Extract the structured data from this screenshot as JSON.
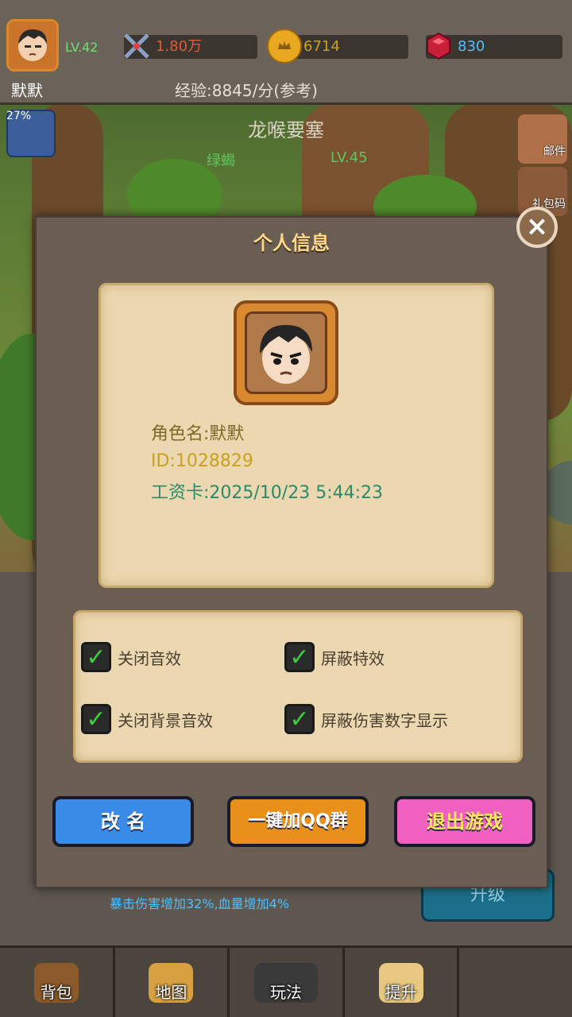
{
  "player": {
    "name": "默默",
    "level": "LV.42",
    "power": "1.80万",
    "gold": "6714",
    "gems": "830",
    "exp_rate": "经验:8845/分(参考)",
    "exp_percent": "27%"
  },
  "map": {
    "title": "龙喉要塞",
    "monster": "绿蝎",
    "monster_level": "LV.45"
  },
  "side_menu": {
    "mail_label": "邮件",
    "gift_label": "礼包码"
  },
  "modal": {
    "title": "个人信息",
    "role_name": "角色名:默默",
    "id": "ID:1028829",
    "salary_card": "工资卡:2025/10/23 5:44:23",
    "options": {
      "mute_sfx": "关闭音效",
      "hide_effects": "屏蔽特效",
      "mute_bgm": "关闭背景音效",
      "hide_damage_numbers": "屏蔽伤害数字显示"
    },
    "buttons": {
      "rename": "改 名",
      "join_qq": "一键加QQ群",
      "quit": "退出游戏"
    }
  },
  "under_panel": {
    "bonus_text": "暴击伤害增加32%,血量增加4%",
    "upgrade_label": "升级"
  },
  "bottom_nav": {
    "bag": "背包",
    "map": "地图",
    "play": "玩法",
    "upgrade": "提升"
  },
  "colors": {
    "level_green": "#6ee06e",
    "power_red": "#e25a3a",
    "gold_text": "#c9a020",
    "gem_text": "#4ec0ff",
    "check_green": "#3ad23a",
    "title_gold": "#ffd98a"
  }
}
